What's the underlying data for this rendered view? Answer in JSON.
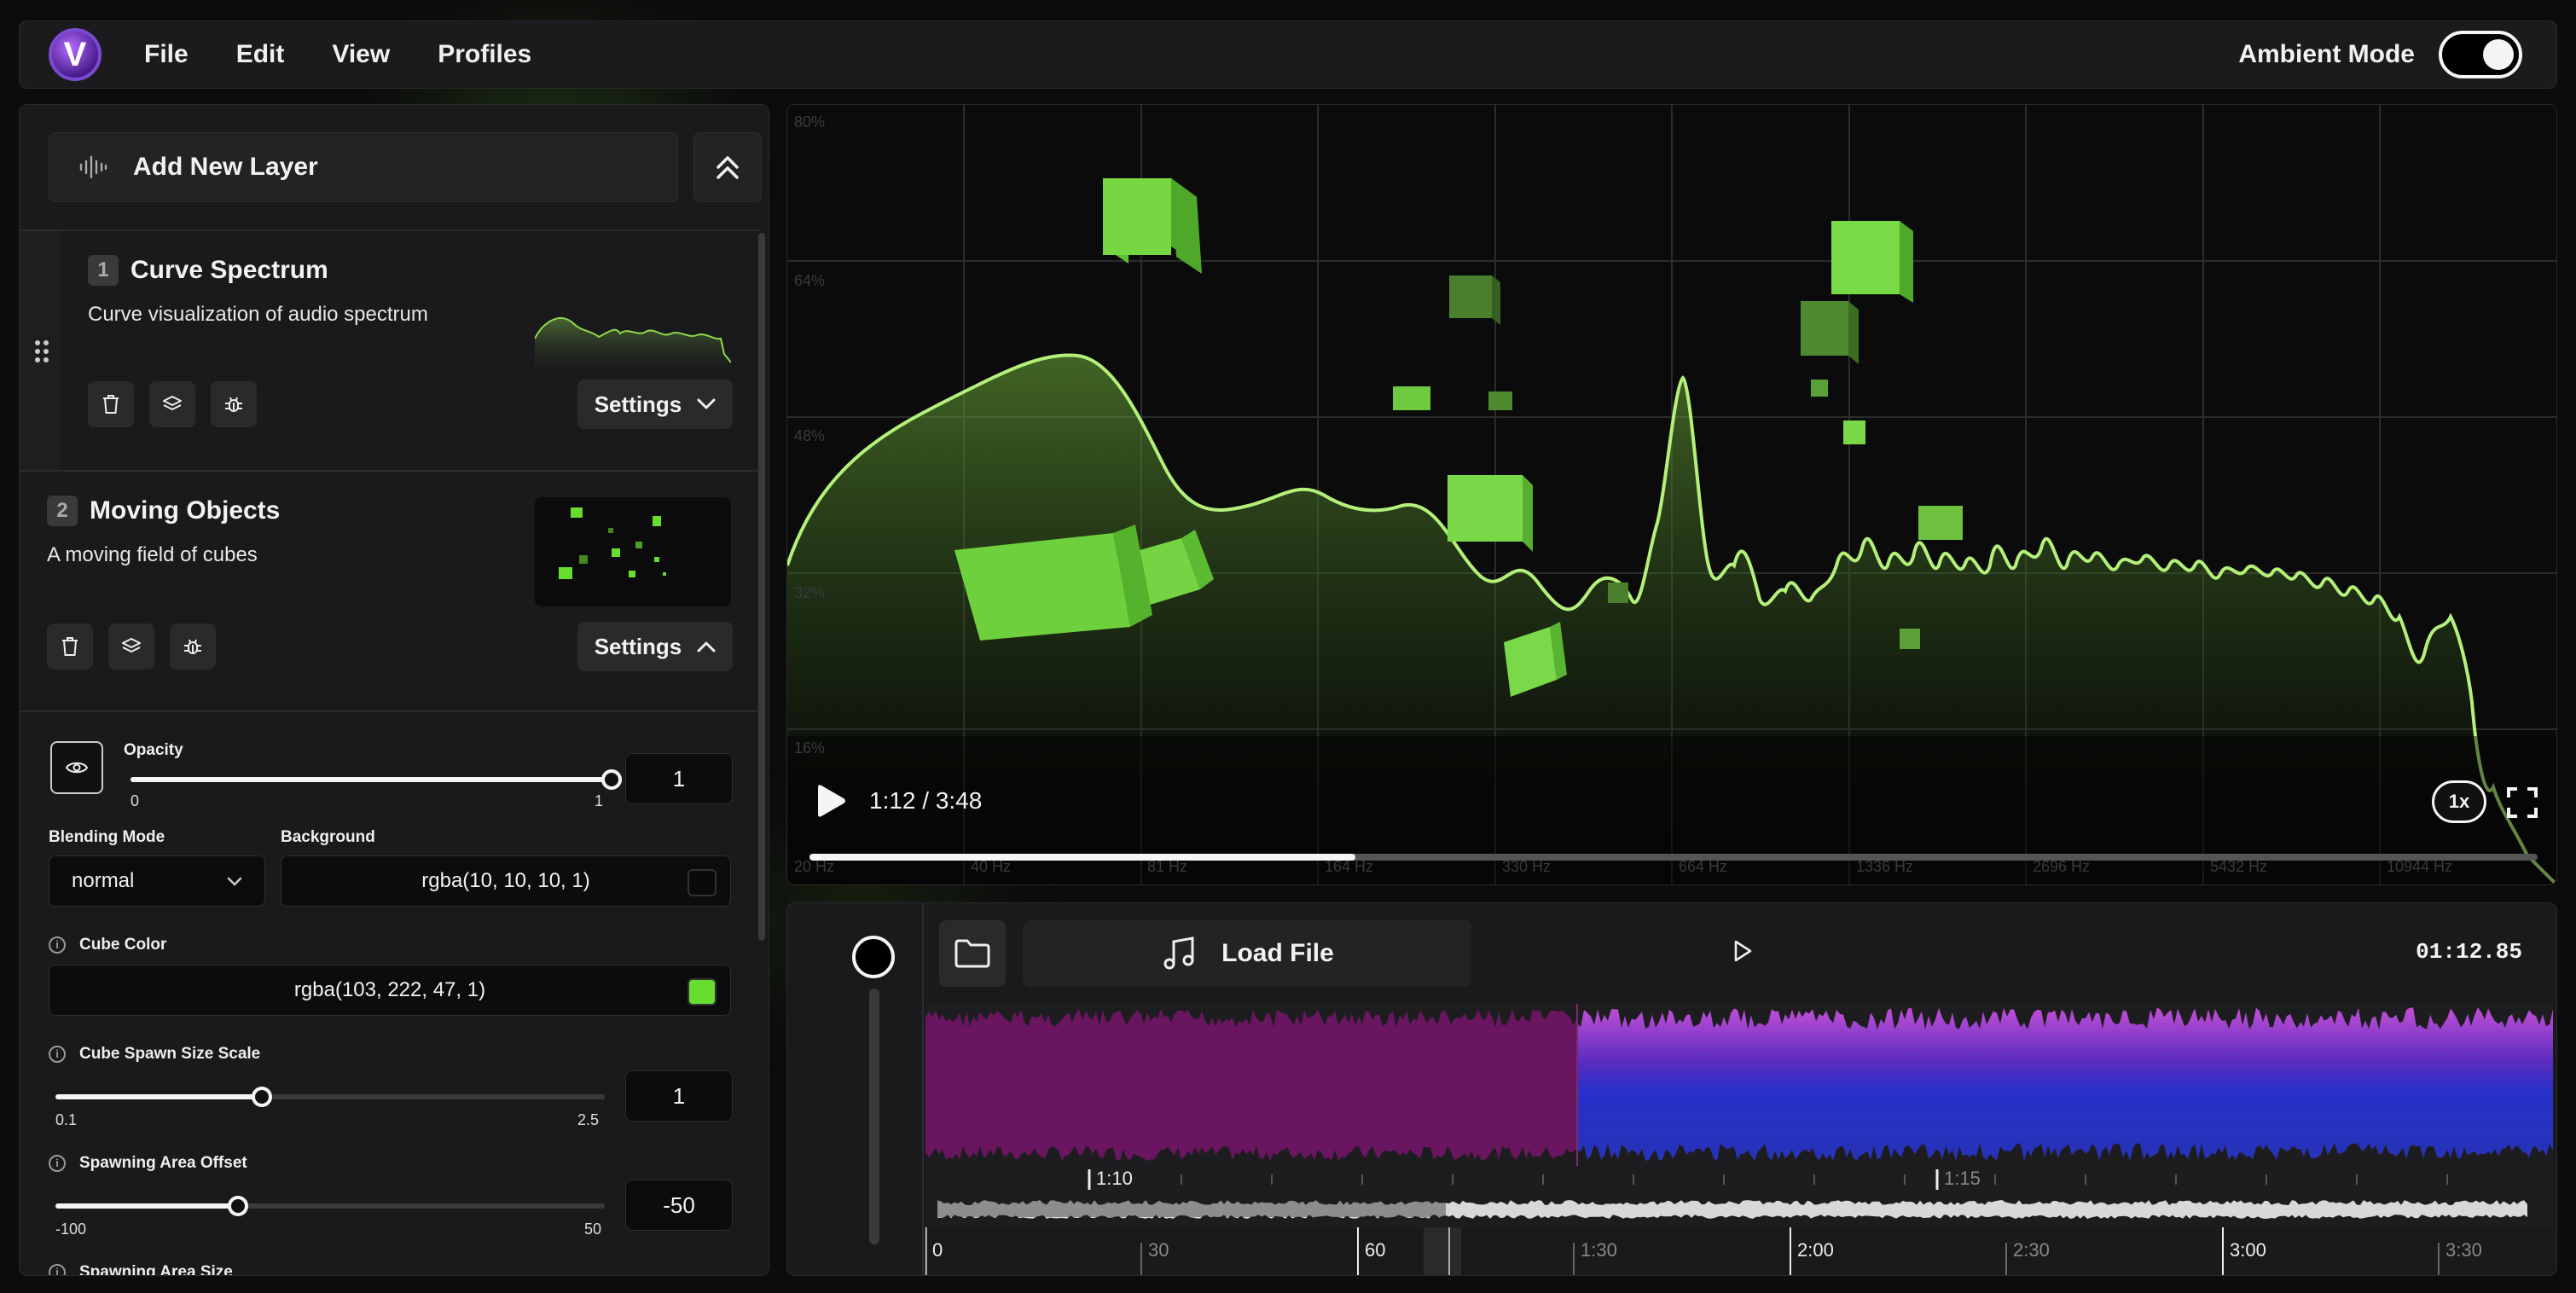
{
  "menu": {
    "items": [
      "File",
      "Edit",
      "View",
      "Profiles"
    ],
    "ambient_label": "Ambient Mode",
    "ambient_on": true
  },
  "sidebar": {
    "add_layer_label": "Add New Layer",
    "layers": [
      {
        "index": "1",
        "title": "Curve Spectrum",
        "description": "Curve visualization of audio spectrum",
        "settings_label": "Settings"
      },
      {
        "index": "2",
        "title": "Moving Objects",
        "description": "A moving field of cubes",
        "settings_label": "Settings"
      }
    ],
    "settings": {
      "opacity": {
        "label": "Opacity",
        "min": "0",
        "max": "1",
        "value": "1",
        "fraction": 1.0
      },
      "blending": {
        "label": "Blending Mode",
        "value": "normal"
      },
      "background": {
        "label": "Background",
        "value": "rgba(10, 10, 10, 1)",
        "swatch": "#0a0a0a"
      },
      "cube_color": {
        "label": "Cube Color",
        "value": "rgba(103, 222, 47, 1)",
        "swatch": "#67de2f"
      },
      "spawn_size": {
        "label": "Cube Spawn Size Scale",
        "min": "0.1",
        "max": "2.5",
        "value": "1",
        "fraction": 0.375
      },
      "spawn_offset": {
        "label": "Spawning Area Offset",
        "min": "-100",
        "max": "50",
        "value": "-50",
        "fraction": 0.333
      },
      "spawn_area": {
        "label": "Spawning Area Size"
      }
    }
  },
  "visualizer": {
    "percent_labels": [
      "80%",
      "64%",
      "48%",
      "32%",
      "16%"
    ],
    "freq_labels": [
      "20 Hz",
      "40 Hz",
      "81 Hz",
      "164 Hz",
      "330 Hz",
      "664 Hz",
      "1336 Hz",
      "2696 Hz",
      "5432 Hz",
      "10944 Hz"
    ],
    "time": "1:12 / 3:48",
    "progress": 0.316,
    "speed": "1x",
    "accent": "#a8f070"
  },
  "timeline": {
    "load_label": "Load File",
    "timecode": "01:12.85",
    "wave_marks": [
      "1:10",
      "1:15"
    ],
    "ruler_labels": [
      "0",
      "30",
      "60",
      "1:30",
      "2:00",
      "2:30",
      "3:00",
      "3:30"
    ]
  }
}
